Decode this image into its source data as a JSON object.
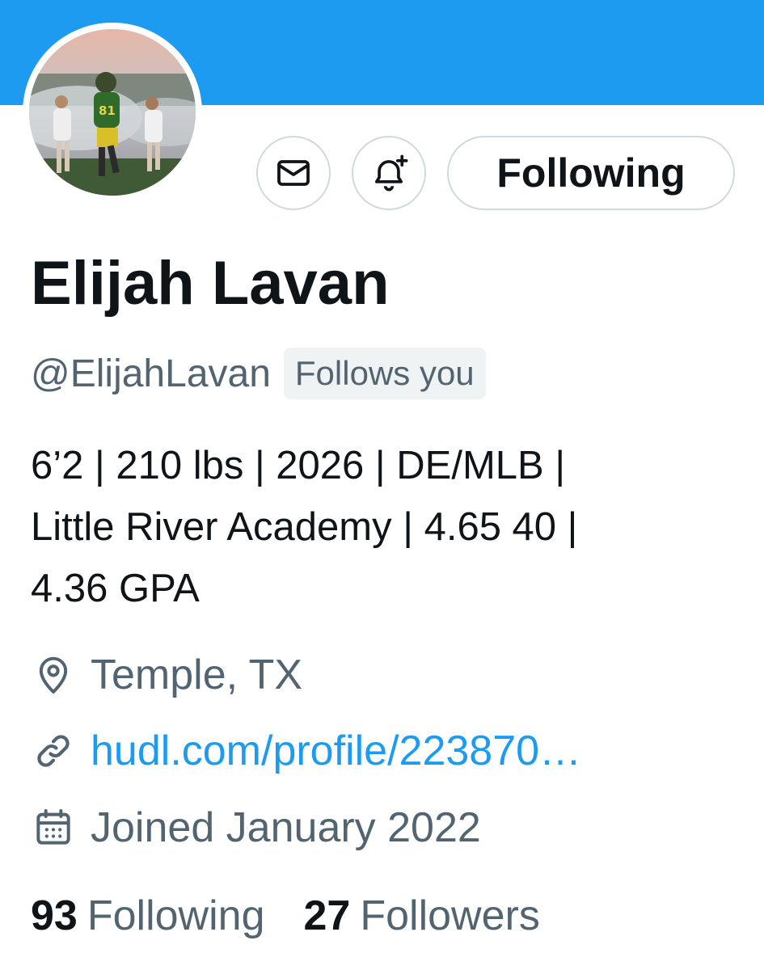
{
  "profile": {
    "name": "Elijah Lavan",
    "handle": "@ElijahLavan",
    "follows_you_badge": "Follows you",
    "bio_lines": [
      "6’2 | 210 lbs | 2026 | DE/MLB |",
      "Little River Academy | 4.65 40 |",
      "4.36 GPA"
    ],
    "location": "Temple, TX",
    "website": "hudl.com/profile/223870…",
    "joined": "Joined January 2022"
  },
  "actions": {
    "message_icon": "envelope-icon",
    "notify_icon": "bell-plus-icon",
    "follow_label": "Following"
  },
  "stats": {
    "following_count": "93",
    "following_label": "Following",
    "followers_count": "27",
    "followers_label": "Followers"
  },
  "icons": {
    "location": "location-pin-icon",
    "link": "link-icon",
    "calendar": "calendar-icon"
  },
  "colors": {
    "banner": "#1d9bf0",
    "link": "#1d9bf0",
    "primary_text": "#0f1419",
    "secondary_text": "#536471",
    "border": "#cfd9de"
  }
}
